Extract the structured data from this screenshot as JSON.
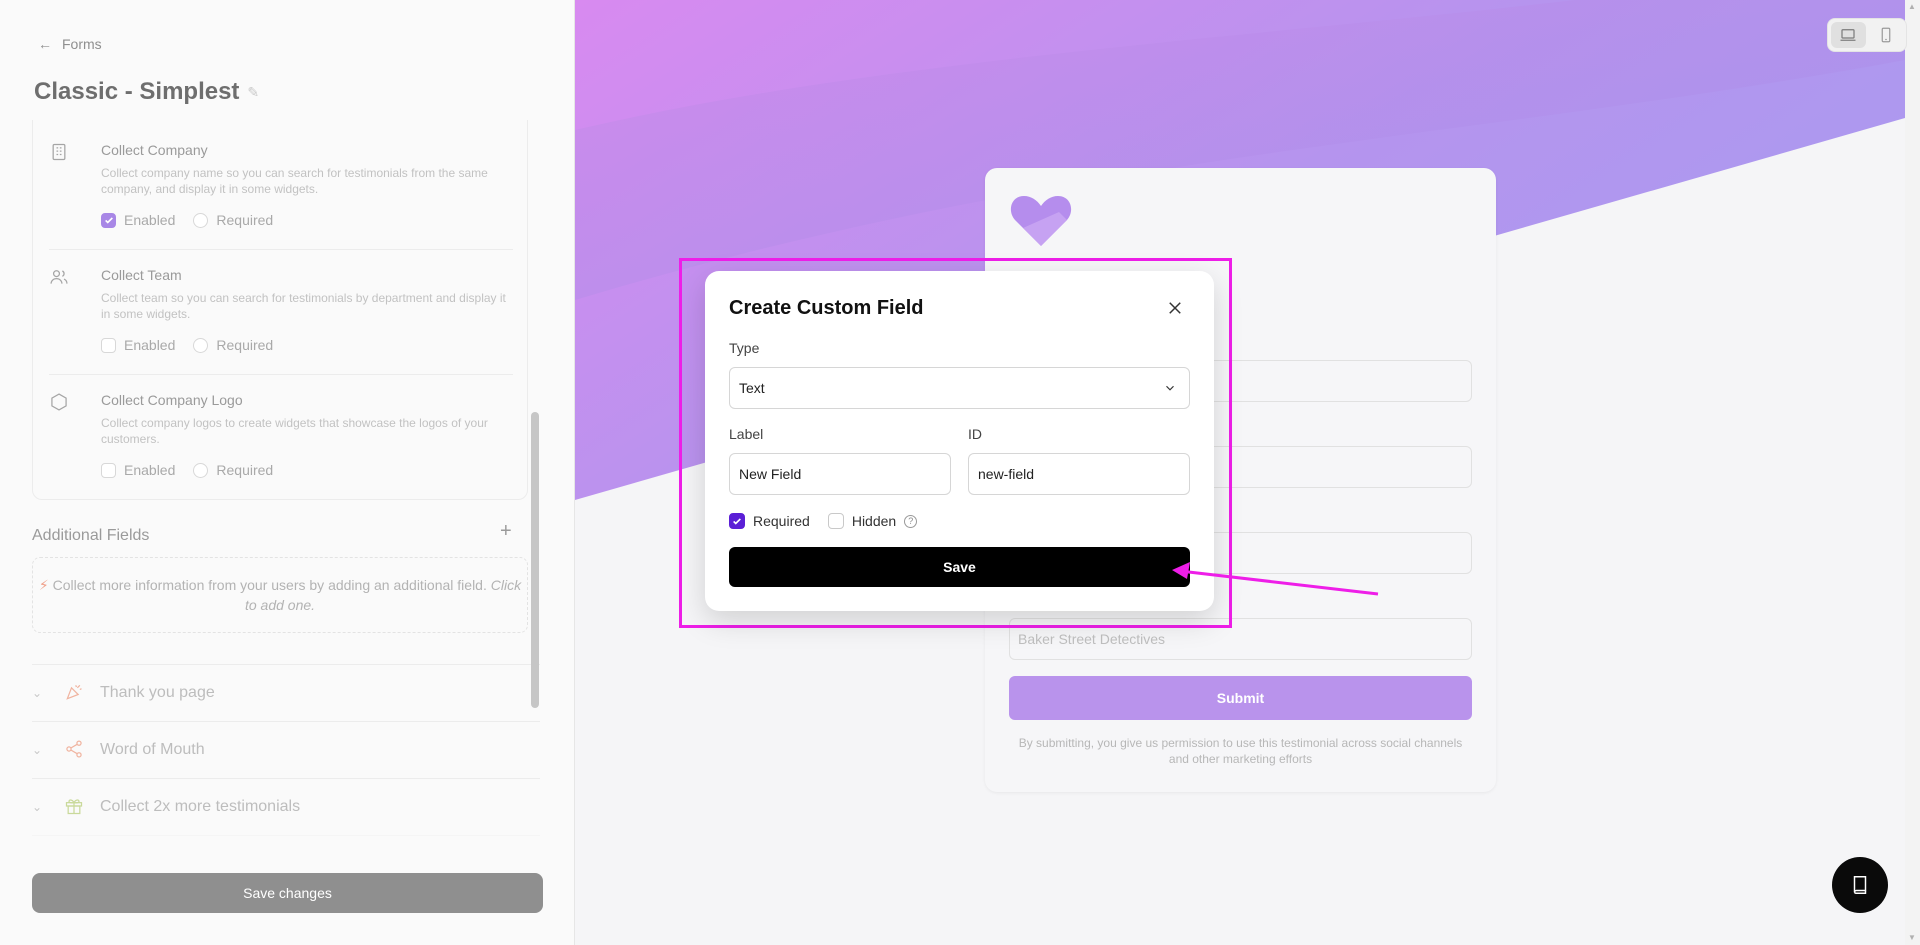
{
  "nav": {
    "back_label": "Forms"
  },
  "page": {
    "title": "Classic - Simplest"
  },
  "collect_fields": [
    {
      "name": "Collect Company",
      "description": "Collect company name so you can search for testimonials from the same company, and display it in some widgets.",
      "enabled_label": "Enabled",
      "required_label": "Required",
      "enabled": true,
      "required": false,
      "icon": "building-icon"
    },
    {
      "name": "Collect Team",
      "description": "Collect team so you can search for testimonials by department and display it in some widgets.",
      "enabled_label": "Enabled",
      "required_label": "Required",
      "enabled": false,
      "required": false,
      "icon": "users-icon"
    },
    {
      "name": "Collect Company Logo",
      "description": "Collect company logos to create widgets that showcase the logos of your customers.",
      "enabled_label": "Enabled",
      "required_label": "Required",
      "enabled": false,
      "required": false,
      "icon": "hexagon-icon"
    }
  ],
  "additional_fields": {
    "title": "Additional Fields",
    "empty_text": "Collect more information from your users by adding an additional field.",
    "empty_cta": "Click to add one."
  },
  "accordion": [
    {
      "label": "Thank you page",
      "icon": "party-popper-icon"
    },
    {
      "label": "Word of Mouth",
      "icon": "share-icon"
    },
    {
      "label": "Collect 2x more testimonials",
      "icon": "gift-icon"
    }
  ],
  "footer": {
    "save_label": "Save changes"
  },
  "preview": {
    "company_placeholder": "Baker Street Detectives",
    "submit_label": "Submit",
    "disclaimer": "By submitting, you give us permission to use this testimonial across social channels and other marketing efforts"
  },
  "modal": {
    "title": "Create Custom Field",
    "type_label": "Type",
    "type_value": "Text",
    "label_label": "Label",
    "label_value": "New Field",
    "id_label": "ID",
    "id_value": "new-field",
    "required_label": "Required",
    "required_checked": true,
    "hidden_label": "Hidden",
    "hidden_checked": false,
    "save_label": "Save"
  },
  "colors": {
    "accent": "#5b1fd6",
    "highlight": "#ee1ee8",
    "brand_purple": "#b993ec"
  }
}
